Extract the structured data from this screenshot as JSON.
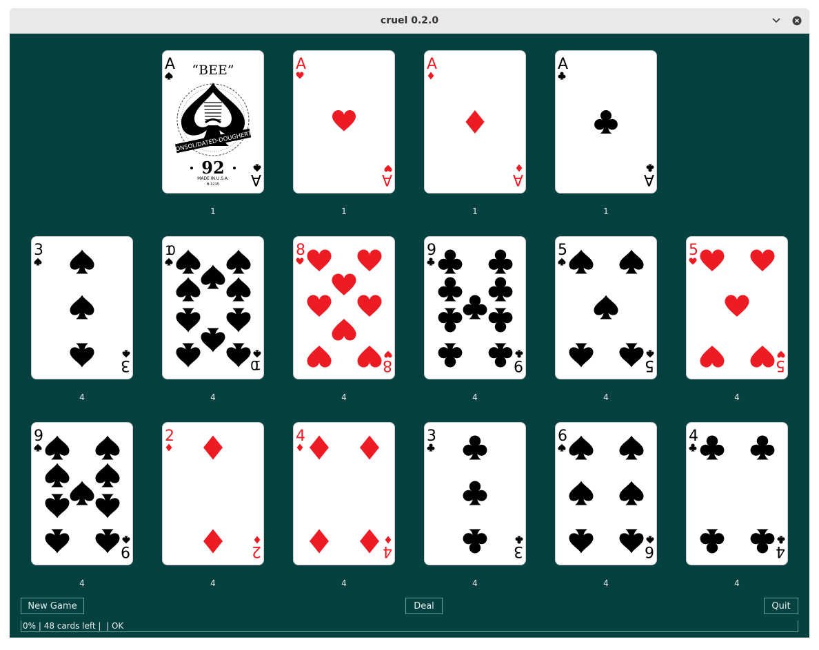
{
  "window": {
    "title": "cruel 0.2.0"
  },
  "colors": {
    "felt": "#06403f",
    "red": "#ed1c24",
    "black": "#000000"
  },
  "foundations": [
    {
      "rank": "A",
      "suit": "spades",
      "count": "1",
      "design": "bee-ace-of-spades",
      "logo_text": {
        "brand": "“BEE”",
        "band": "CONSOLIDATED-DOUGHERTY",
        "number": "92",
        "made": "MADE IN U.S.A.",
        "code": "B-1215"
      }
    },
    {
      "rank": "A",
      "suit": "hearts",
      "count": "1"
    },
    {
      "rank": "A",
      "suit": "diamonds",
      "count": "1"
    },
    {
      "rank": "A",
      "suit": "clubs",
      "count": "1"
    }
  ],
  "tableau": [
    [
      {
        "rank": "3",
        "suit": "spades",
        "count": "4"
      },
      {
        "rank": "10",
        "suit": "spades",
        "count": "4"
      },
      {
        "rank": "8",
        "suit": "hearts",
        "count": "4"
      },
      {
        "rank": "9",
        "suit": "clubs",
        "count": "4"
      },
      {
        "rank": "5",
        "suit": "spades",
        "count": "4"
      },
      {
        "rank": "5",
        "suit": "hearts",
        "count": "4"
      }
    ],
    [
      {
        "rank": "9",
        "suit": "spades",
        "count": "4"
      },
      {
        "rank": "2",
        "suit": "diamonds",
        "count": "4"
      },
      {
        "rank": "4",
        "suit": "diamonds",
        "count": "4"
      },
      {
        "rank": "3",
        "suit": "clubs",
        "count": "4"
      },
      {
        "rank": "6",
        "suit": "spades",
        "count": "4"
      },
      {
        "rank": "4",
        "suit": "clubs",
        "count": "4"
      }
    ]
  ],
  "buttons": {
    "new_game": "New Game",
    "deal": "Deal",
    "quit": "Quit"
  },
  "status": {
    "progress": "0%",
    "cards_left": "48 cards left",
    "extra": "",
    "message": "OK"
  },
  "icons": {
    "menu": "chevron-down-icon",
    "close": "close-icon"
  }
}
